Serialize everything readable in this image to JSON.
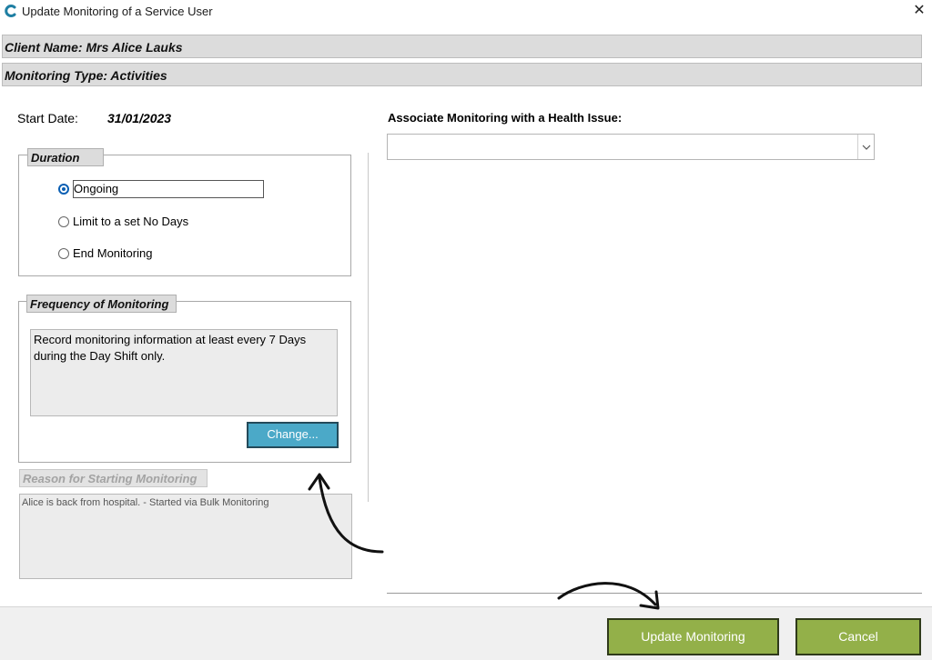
{
  "window": {
    "title": "Update Monitoring of a Service User",
    "close_symbol": "✕"
  },
  "header": {
    "client_name": "Client Name: Mrs Alice Lauks",
    "monitoring_type": "Monitoring Type: Activities"
  },
  "start_date": {
    "label": "Start Date:",
    "value": "31/01/2023"
  },
  "duration": {
    "title": "Duration",
    "options": [
      {
        "label": "Ongoing",
        "checked": true
      },
      {
        "label": "Limit to a set No Days",
        "checked": false
      },
      {
        "label": "End Monitoring",
        "checked": false
      }
    ]
  },
  "frequency": {
    "title": "Frequency of Monitoring",
    "text": "Record monitoring information at least every 7 Days during the Day Shift only.",
    "change_label": "Change..."
  },
  "reason": {
    "title": "Reason for Starting Monitoring",
    "text": "Alice is back from hospital. - Started via Bulk Monitoring"
  },
  "health_issue": {
    "label": "Associate Monitoring with a Health Issue:",
    "selected": ""
  },
  "footer": {
    "update_label": "Update Monitoring",
    "cancel_label": "Cancel"
  },
  "colors": {
    "accent_button": "#4ba9c8",
    "footer_button": "#93b049",
    "header_band": "#dcdcdc"
  },
  "icons": {
    "app": "app-logo-icon",
    "close": "close-icon",
    "dropdown": "chevron-down-icon"
  }
}
